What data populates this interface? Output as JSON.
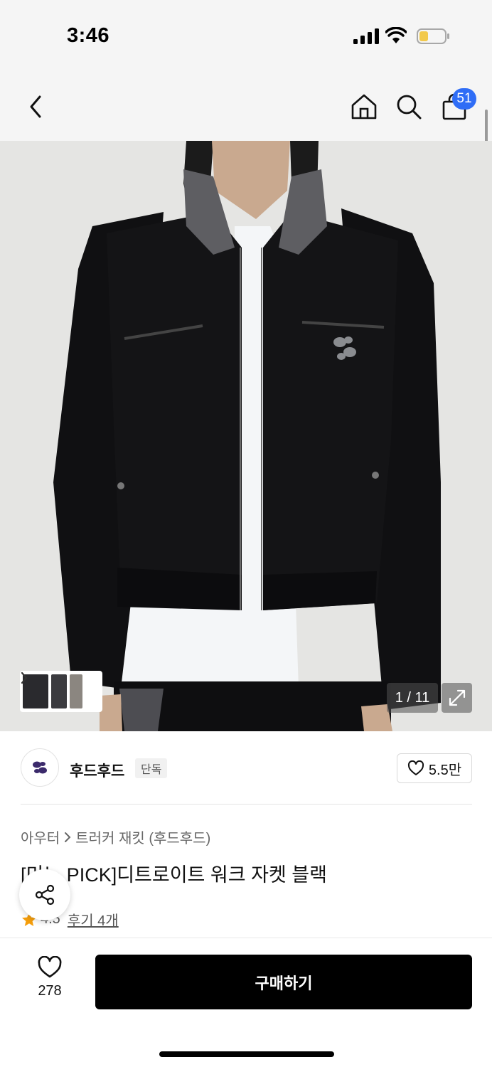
{
  "status_bar": {
    "time": "3:46"
  },
  "nav": {
    "cart_count": "51"
  },
  "gallery": {
    "counter": "1 / 11",
    "image_description_icon": "jacket-product-photo"
  },
  "brand": {
    "name": "후드후드",
    "badge": "단독",
    "likes": "5.5만"
  },
  "product": {
    "breadcrumb": [
      "아우터",
      "트러커 재킷 (후드후드)"
    ],
    "title": "[미노 PICK]디트로이트 워크 자켓 블랙",
    "rating": "4.5",
    "reviews": "후기 4개"
  },
  "bottom": {
    "wish_count": "278",
    "buy_label": "구매하기"
  },
  "colors": {
    "accent_badge": "#2f6df6",
    "buy_button": "#000000",
    "star": "#f59e0b"
  }
}
